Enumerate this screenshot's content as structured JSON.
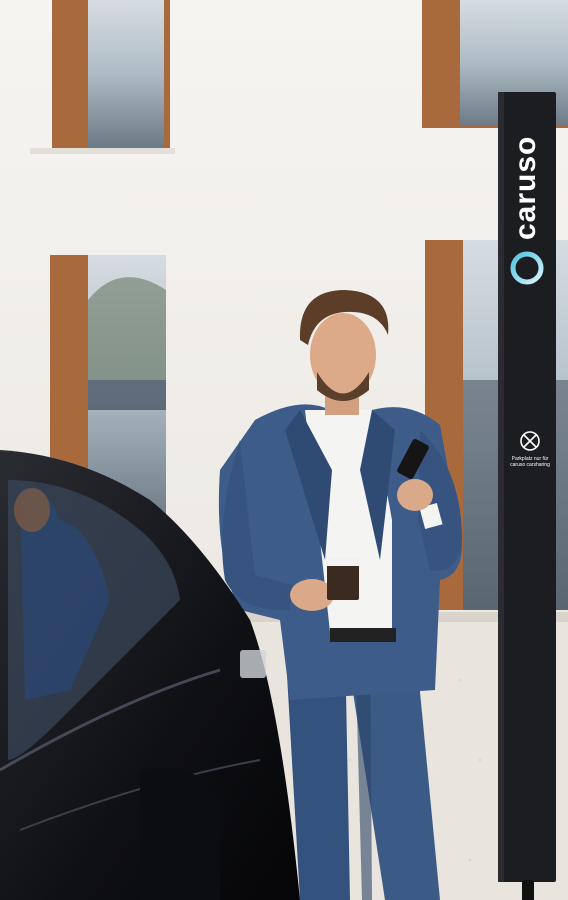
{
  "photo": {
    "subject": "person-with-phone-and-coffee",
    "colors": {
      "wall": "#f2f0ec",
      "window_frame": "#a86a3c",
      "window_glass": "#c7d0d6",
      "pole": "#1c1d21",
      "suit": "#3b5a86",
      "shirt": "#f5f5f5",
      "car": "#121317",
      "gravel": "#ece8e2"
    }
  },
  "charging_pole": {
    "brand": "caruso",
    "logo_icon": "ring-logo-icon",
    "parking_icon": "no-parking-icon",
    "caption": "Parkplatz nur für caruso carsharing"
  }
}
